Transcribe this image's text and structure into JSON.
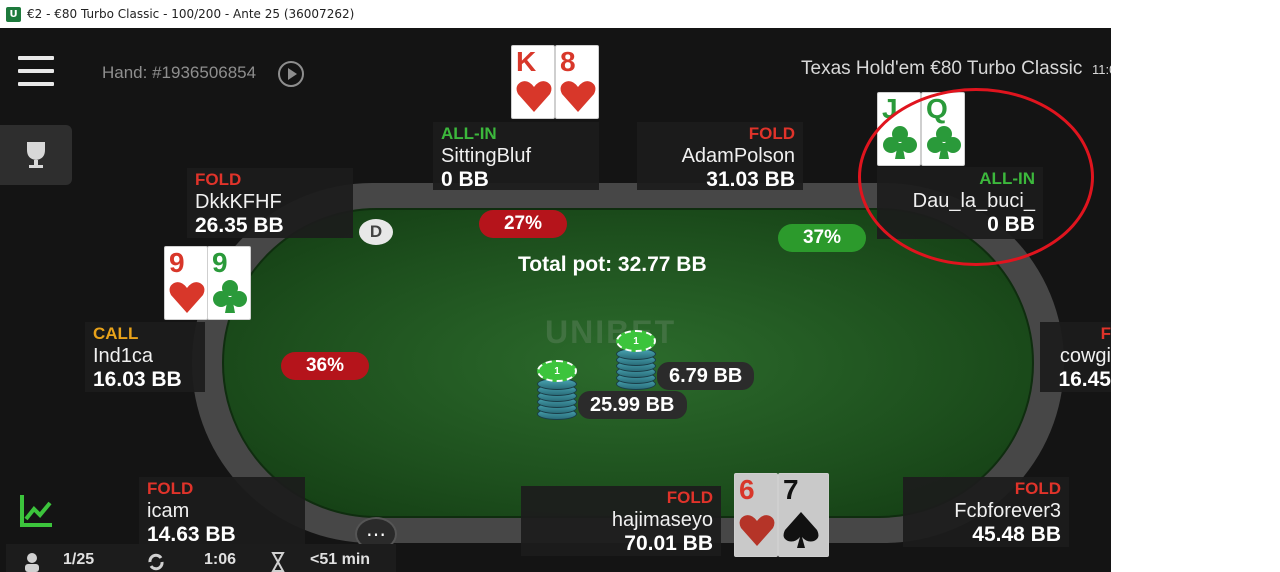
{
  "window": {
    "title": "€2 - €80 Turbo Classic - 100/200 - Ante 25 (36007262)",
    "icon": "unibet-app-icon"
  },
  "header": {
    "hand_id": "Hand: #1936506854",
    "game_info": "Texas Hold'em  €80 Turbo Classic",
    "clock": "11:0"
  },
  "brand": "UNIBET",
  "pot": {
    "total": "Total pot: 32.77 BB"
  },
  "dealer_button": "D",
  "more_button": "⋯",
  "seats": {
    "dkk": {
      "action": "FOLD",
      "name": "DkkKFHF",
      "stack": "26.35 BB"
    },
    "sitting": {
      "action": "ALL-IN",
      "name": "SittingBluf",
      "stack": "0 BB"
    },
    "adam": {
      "action": "FOLD",
      "name": "AdamPolson",
      "stack": "31.03 BB"
    },
    "dau": {
      "action": "ALL-IN",
      "name": "Dau_la_buci_",
      "stack": "0 BB"
    },
    "ind": {
      "action": "CALL",
      "name": "Ind1ca",
      "stack": "16.03 BB"
    },
    "cowgirl": {
      "action": "F",
      "name": "cowgi",
      "stack": "16.45"
    },
    "icam": {
      "action": "FOLD",
      "name": "icam",
      "stack": "14.63 BB"
    },
    "haji": {
      "action": "FOLD",
      "name": "hajimaseyo",
      "stack": "70.01 BB"
    },
    "fcb": {
      "action": "FOLD",
      "name": "Fcbforever3",
      "stack": "45.48 BB"
    }
  },
  "cards": {
    "sitting": [
      {
        "rank": "K",
        "suit": "hearts"
      },
      {
        "rank": "8",
        "suit": "hearts"
      }
    ],
    "dau": [
      {
        "rank": "J",
        "suit": "clubs"
      },
      {
        "rank": "Q",
        "suit": "clubs"
      }
    ],
    "ind": [
      {
        "rank": "9",
        "suit": "hearts"
      },
      {
        "rank": "9",
        "suit": "clubs"
      }
    ],
    "haji": [
      {
        "rank": "6",
        "suit": "hearts"
      },
      {
        "rank": "7",
        "suit": "spades"
      }
    ]
  },
  "equity": {
    "sitting": "27%",
    "dau": "37%",
    "ind": "36%"
  },
  "bets": {
    "main": "25.99 BB",
    "side": "6.79 BB"
  },
  "chip_label": "1",
  "bottom_bar": {
    "hands": "1/25",
    "time": "1:06",
    "duration": "<51 min"
  },
  "colors": {
    "fold": "#e0332a",
    "allin": "#3cb83c",
    "call": "#e8a21a",
    "highlight": "#e0141e",
    "felt": "#1d4f1d"
  }
}
